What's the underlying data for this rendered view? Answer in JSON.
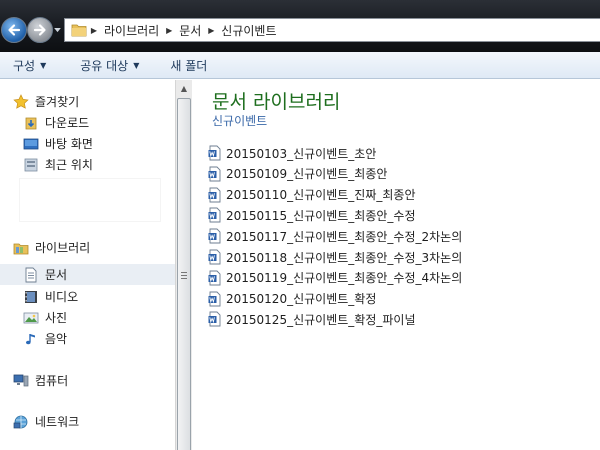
{
  "address": {
    "breadcrumbs": [
      "라이브러리",
      "문서",
      "신규이벤트"
    ]
  },
  "toolbar": {
    "organize_label": "구성",
    "share_label": "공유 대상",
    "new_folder_label": "새 폴더"
  },
  "sidebar": {
    "favorites": {
      "label": "즐겨찾기",
      "items": [
        {
          "label": "다운로드",
          "icon": "download-folder-icon"
        },
        {
          "label": "바탕 화면",
          "icon": "desktop-icon"
        },
        {
          "label": "최근 위치",
          "icon": "recent-places-icon"
        }
      ]
    },
    "libraries": {
      "label": "라이브러리",
      "items": [
        {
          "label": "문서",
          "icon": "documents-icon",
          "selected": true
        },
        {
          "label": "비디오",
          "icon": "video-icon"
        },
        {
          "label": "사진",
          "icon": "pictures-icon"
        },
        {
          "label": "음악",
          "icon": "music-icon"
        }
      ]
    },
    "computer": {
      "label": "컴퓨터"
    },
    "network": {
      "label": "네트워크"
    }
  },
  "main": {
    "library_title": "문서 라이브러리",
    "folder_name": "신규이벤트",
    "files": [
      "20150103_신규이벤트_초안",
      "20150109_신규이벤트_최종안",
      "20150110_신규이벤트_진짜_최종안",
      "20150115_신규이벤트_최종안_수정",
      "20150117_신규이벤트_최종안_수정_2차논의",
      "20150118_신규이벤트_최종안_수정_3차논의",
      "20150119_신규이벤트_최종안_수정_4차논의",
      "20150120_신규이벤트_확정",
      "20150125_신규이벤트_확정_파이널"
    ]
  },
  "colors": {
    "library_title": "#1e6e1e",
    "folder_link": "#3a68a8",
    "selection": "#e9eef4"
  }
}
